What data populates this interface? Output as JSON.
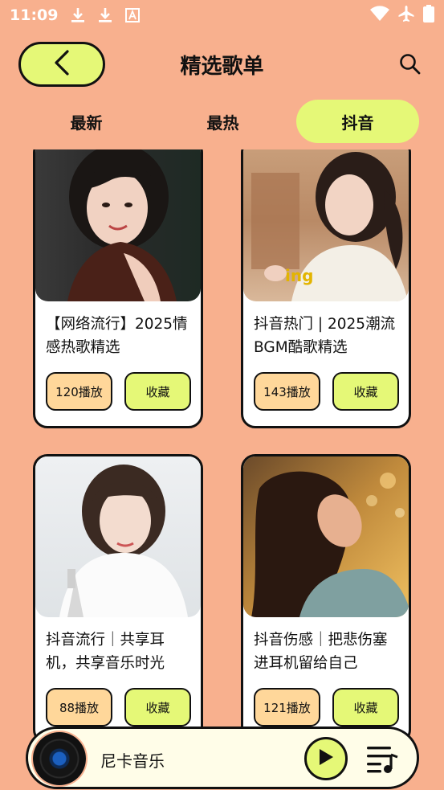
{
  "status_bar": {
    "time": "11:09",
    "icons": [
      "download-icon",
      "download-icon",
      "font-icon"
    ],
    "right_icons": [
      "wifi-icon",
      "airplane-icon",
      "battery-icon"
    ]
  },
  "header": {
    "back_icon": "chevron-left-icon",
    "title": "精选歌单",
    "search_icon": "search-icon"
  },
  "tabs": [
    {
      "label": "最新",
      "active": false
    },
    {
      "label": "最热",
      "active": false
    },
    {
      "label": "抖音",
      "active": true
    }
  ],
  "playlists": [
    {
      "title": "【网络流行】2025情感热歌精选",
      "plays": "120播放",
      "fav_label": "收藏"
    },
    {
      "title": "抖音热门 | 2025潮流BGM酷歌精选",
      "plays": "143播放",
      "fav_label": "收藏"
    },
    {
      "title": "抖音流行｜共享耳机，共享音乐时光",
      "plays": "88播放",
      "fav_label": "收藏"
    },
    {
      "title": "抖音伤感｜把悲伤塞进耳机留给自己",
      "plays": "121播放",
      "fav_label": "收藏"
    }
  ],
  "player": {
    "name": "尼卡音乐",
    "play_icon": "play-icon",
    "playlist_icon": "playlist-icon"
  },
  "colors": {
    "background": "#F8B08E",
    "accent": "#E5F877",
    "plays_pill": "#FFD79A"
  }
}
